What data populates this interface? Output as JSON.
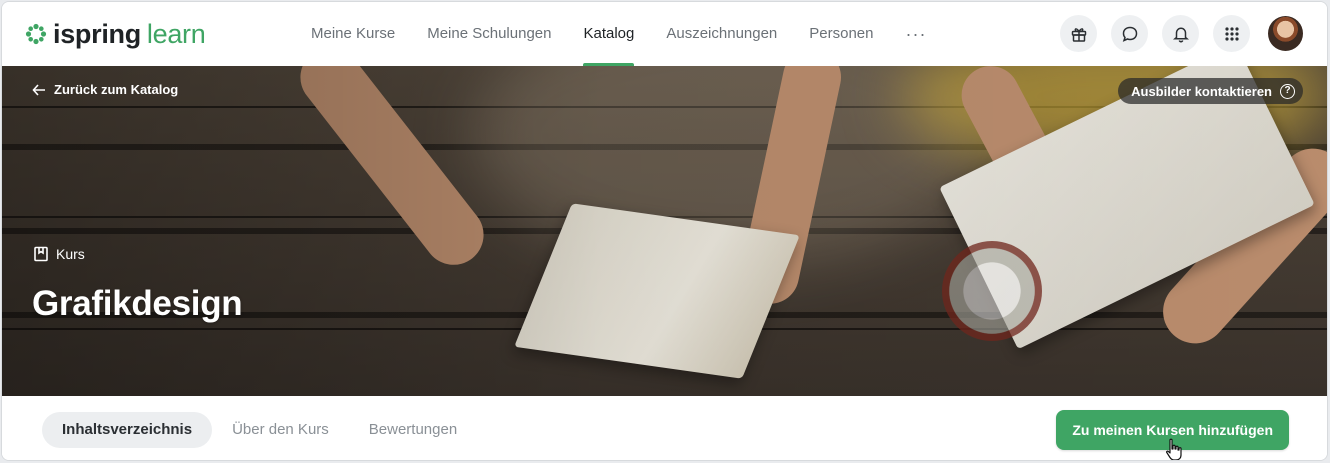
{
  "app": {
    "brand_part1": "ispring",
    "brand_part2": "learn",
    "brand_color": "#3fa564"
  },
  "nav": {
    "items": [
      {
        "label": "Meine Kurse"
      },
      {
        "label": "Meine Schulungen"
      },
      {
        "label": "Katalog",
        "active": true
      },
      {
        "label": "Auszeichnungen"
      },
      {
        "label": "Personen"
      }
    ],
    "more": "···"
  },
  "tools": [
    "gift-icon",
    "chat-icon",
    "bell-icon",
    "apps-grid-icon",
    "avatar"
  ],
  "hero": {
    "back_label": "Zurück zum Katalog",
    "contact_label": "Ausbilder kontaktieren",
    "help_glyph": "?",
    "type_label": "Kurs",
    "title": "Grafikdesign"
  },
  "tabs": {
    "items": [
      {
        "label": "Inhaltsverzeichnis",
        "active": true
      },
      {
        "label": "Über den Kurs"
      },
      {
        "label": "Bewertungen"
      }
    ],
    "add_button": "Zu meinen Kursen hinzufügen"
  }
}
